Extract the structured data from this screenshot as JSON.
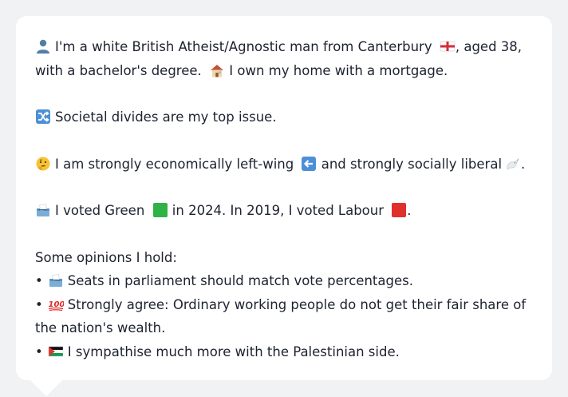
{
  "profile": {
    "line1_a": "I'm a white British Atheist/Agnostic man from Canterbury",
    "line1_b": ", aged 38,",
    "line2_a": "with a bachelor's degree.",
    "line2_b": "I own my home with a mortgage.",
    "icons": [
      "person-icon",
      "england-flag-icon",
      "house-icon"
    ]
  },
  "issue": {
    "text": "Societal divides are my top issue.",
    "icon": "shuffle-icon"
  },
  "ideology": {
    "a": "I am strongly economically left-wing",
    "b": "and strongly socially liberal",
    "c": ".",
    "icons": [
      "thinking-face-icon",
      "left-arrow-icon",
      "dove-icon"
    ]
  },
  "votes": {
    "a": "I voted Green",
    "b": "in 2024. In 2019, I voted Labour",
    "c": ".",
    "colors": {
      "green": "#2fb344",
      "labour": "#e0302c"
    },
    "icons": [
      "ballot-box-icon",
      "green-square-icon",
      "red-square-icon"
    ]
  },
  "opinions": {
    "heading": "Some opinions I hold:",
    "bullet": "•",
    "items": [
      {
        "icon": "ballot-box-icon",
        "text": "Seats in parliament should match vote percentages."
      },
      {
        "icon": "hundred-points-icon",
        "text_a": "Strongly agree: Ordinary working people do not get their fair share of",
        "text_b": "the nation's wealth."
      },
      {
        "icon": "palestine-flag-icon",
        "text": "I sympathise much more with the Palestinian side."
      }
    ]
  }
}
